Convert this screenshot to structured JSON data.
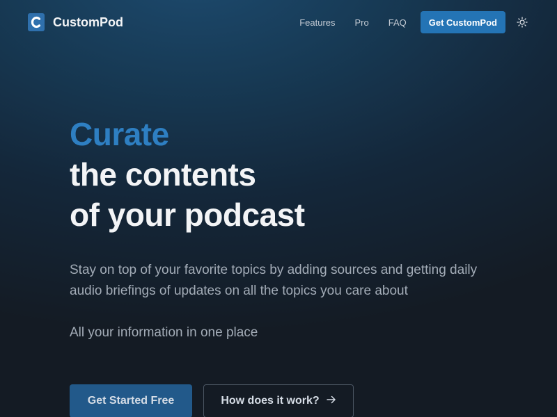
{
  "nav": {
    "brand": "CustomPod",
    "links": [
      "Features",
      "Pro",
      "FAQ"
    ],
    "cta": "Get CustomPod",
    "theme_icon": "sun-icon"
  },
  "hero": {
    "line1": "Curate",
    "line2": "the contents",
    "line3": "of your podcast",
    "lead": "Stay on top of your favorite topics by adding sources and getting daily audio briefings of updates on all the topics you care about",
    "sub": "All your information in one place"
  },
  "cta": {
    "primary": "Get Started Free",
    "secondary": "How does it work?",
    "secondary_icon": "arrow-right-icon"
  },
  "colors": {
    "accent": "#2e7fc2",
    "button": "#2474b5",
    "background": "#141b24"
  }
}
